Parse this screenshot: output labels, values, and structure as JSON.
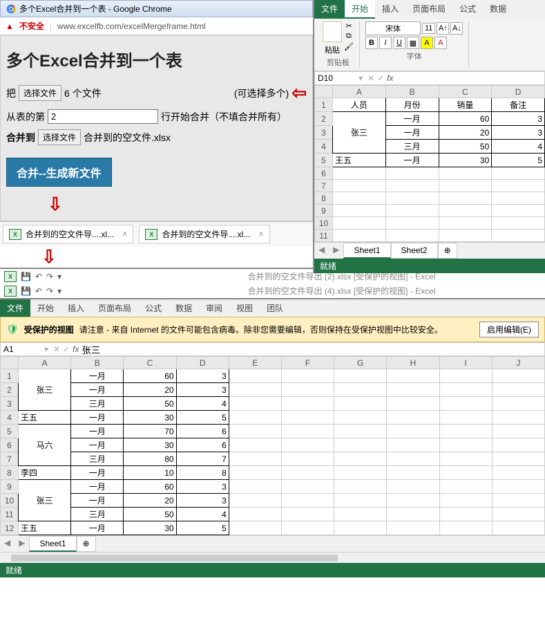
{
  "browser": {
    "tab_title": "多个Excel合并到一个表 - Google Chrome",
    "insecure_label": "不安全",
    "url": "www.excelfb.com/excelMergeframe.html"
  },
  "page": {
    "heading": "多个Excel合并到一个表",
    "ba_label": "把",
    "choose_file_btn": "选择文件",
    "file_count": "6 个文件",
    "multi_hint": "(可选择多个)",
    "from_row_prefix": "从表的第",
    "from_row_value": "2",
    "from_row_suffix": "行开始合并（不填合并所有）",
    "merge_to_label": "合并到",
    "merge_to_file": "合并到的空文件.xlsx",
    "merge_button": "合并--生成新文件"
  },
  "downloads": {
    "item1": "合并到的空文件导....xl...",
    "item2": "合并到的空文件导....xl..."
  },
  "excel_right": {
    "tabs": {
      "file": "文件",
      "home": "开始",
      "insert": "插入",
      "layout": "页面布局",
      "formula": "公式",
      "data": "数据"
    },
    "clipboard_label": "剪贴板",
    "paste_label": "粘贴",
    "font_label": "字体",
    "font_name": "宋体",
    "font_size": "11",
    "namebox": "D10",
    "chart_data": {
      "type": "table",
      "headers": [
        "人员",
        "月份",
        "销量",
        "备注"
      ],
      "rows": [
        [
          "张三",
          "一月",
          60,
          3
        ],
        [
          "",
          "一月",
          20,
          3
        ],
        [
          "",
          "三月",
          50,
          4
        ],
        [
          "王五",
          "一月",
          30,
          5
        ]
      ],
      "merged": {
        "col": 0,
        "start": 0,
        "end": 2,
        "value": "张三"
      }
    },
    "sheet_tab1": "Sheet1",
    "sheet_tab2": "Sheet2",
    "status": "就绪"
  },
  "excel_mid": {
    "title1": "合并到的空文件导出 (2).xlsx  [受保护的视图] - Excel",
    "title2": "合并到的空文件导出 (4).xlsx  [受保护的视图] - Excel"
  },
  "excel_bottom": {
    "tabs": {
      "file": "文件",
      "home": "开始",
      "insert": "插入",
      "layout": "页面布局",
      "formula": "公式",
      "data": "数据",
      "review": "审阅",
      "view": "视图",
      "team": "团队"
    },
    "protected_label": "受保护的视图",
    "protected_msg": "请注意 - 来自 Internet 的文件可能包含病毒。除非您需要编辑，否则保持在受保护视图中比较安全。",
    "enable_edit": "启用编辑(E)",
    "namebox": "A1",
    "formula_val": "张三",
    "chart_data": {
      "type": "table",
      "columns": [
        "A",
        "B",
        "C",
        "D"
      ],
      "rows": [
        [
          "张三",
          "一月",
          60,
          3
        ],
        [
          "",
          "一月",
          20,
          3
        ],
        [
          "",
          "三月",
          50,
          4
        ],
        [
          "王五",
          "一月",
          30,
          5
        ],
        [
          "马六",
          "一月",
          70,
          6
        ],
        [
          "",
          "一月",
          30,
          6
        ],
        [
          "",
          "三月",
          80,
          7
        ],
        [
          "李四",
          "一月",
          10,
          8
        ],
        [
          "张三",
          "一月",
          60,
          3
        ],
        [
          "",
          "一月",
          20,
          3
        ],
        [
          "",
          "三月",
          50,
          4
        ],
        [
          "王五",
          "一月",
          30,
          5
        ]
      ],
      "merges": [
        {
          "col": 0,
          "start": 0,
          "end": 2,
          "value": "张三"
        },
        {
          "col": 0,
          "start": 4,
          "end": 6,
          "value": "马六"
        },
        {
          "col": 0,
          "start": 8,
          "end": 10,
          "value": "张三"
        }
      ]
    },
    "sheet_tab": "Sheet1",
    "status": "就绪"
  }
}
